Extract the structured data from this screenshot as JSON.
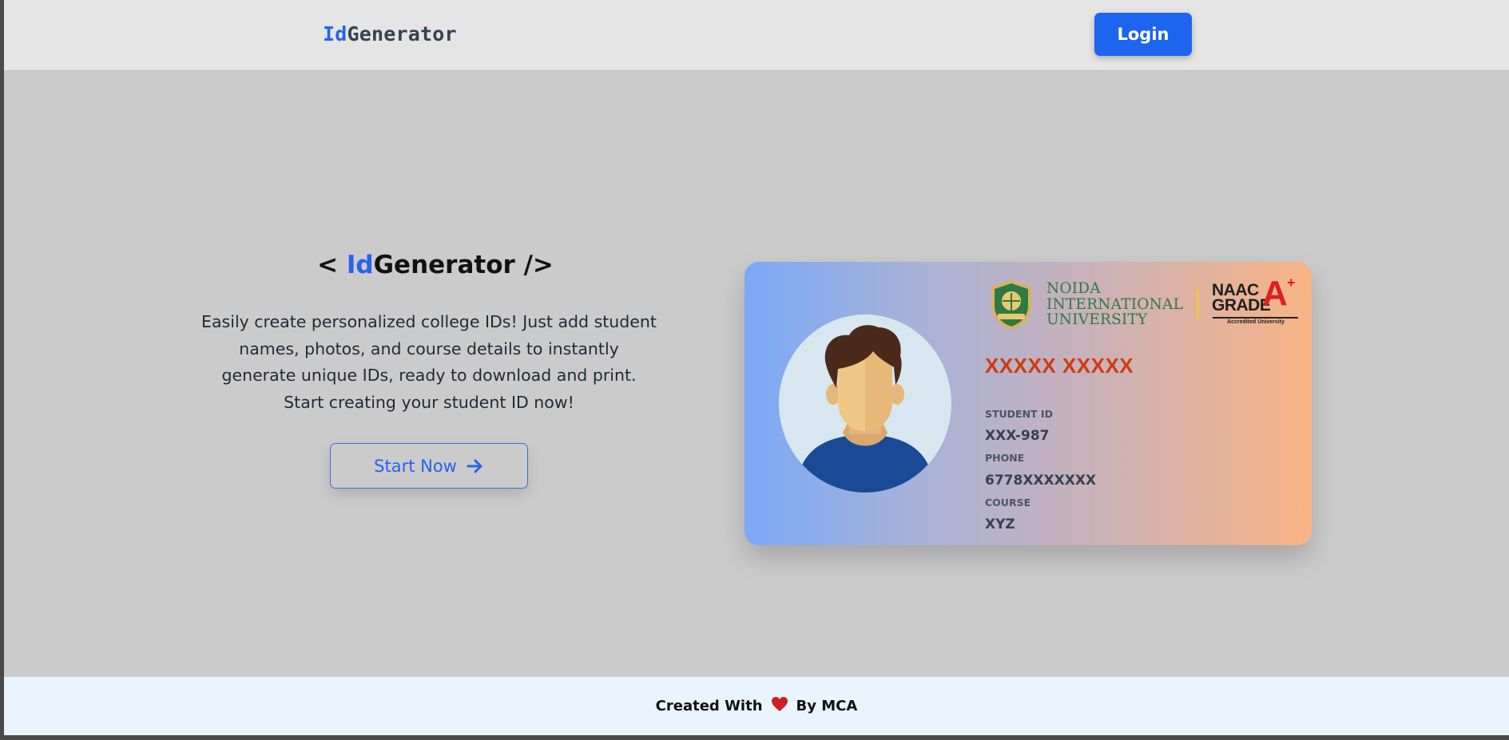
{
  "header": {
    "logo_prefix": "Id",
    "logo_suffix": "Generator",
    "login_label": "Login"
  },
  "hero": {
    "title_open": "< ",
    "title_accent": "Id",
    "title_main": "Generator",
    "title_close": " />",
    "description": "Easily create personalized college IDs! Just add student names, photos, and course details to instantly generate unique IDs, ready to download and print. Start creating your student ID now!",
    "cta_label": "Start Now",
    "cta_icon": "arrow-right-icon"
  },
  "card": {
    "university_lines": [
      "NOIDA",
      "INTERNATIONAL",
      "UNIVERSITY"
    ],
    "naac_line1": "NAAC",
    "naac_line2": "GRADE",
    "naac_grade": "A",
    "naac_plus": "+",
    "naac_sub": "Accredited University",
    "student_name": "XXXXX XXXXX",
    "fields": [
      {
        "label": "STUDENT ID",
        "value": "XXX-987"
      },
      {
        "label": "PHONE",
        "value": "6778XXXXXXX"
      },
      {
        "label": "COURSE",
        "value": "XYZ"
      }
    ],
    "colors": {
      "name": "#cf3b12",
      "university": "#2f7a3f",
      "naac_red": "#e11d24"
    }
  },
  "footer": {
    "prefix": "Created With",
    "icon": "heart-icon",
    "suffix": "By MCA"
  },
  "colors": {
    "accent": "#2563eb",
    "login_bg": "#1d64ef",
    "heart": "#d01f1f"
  }
}
